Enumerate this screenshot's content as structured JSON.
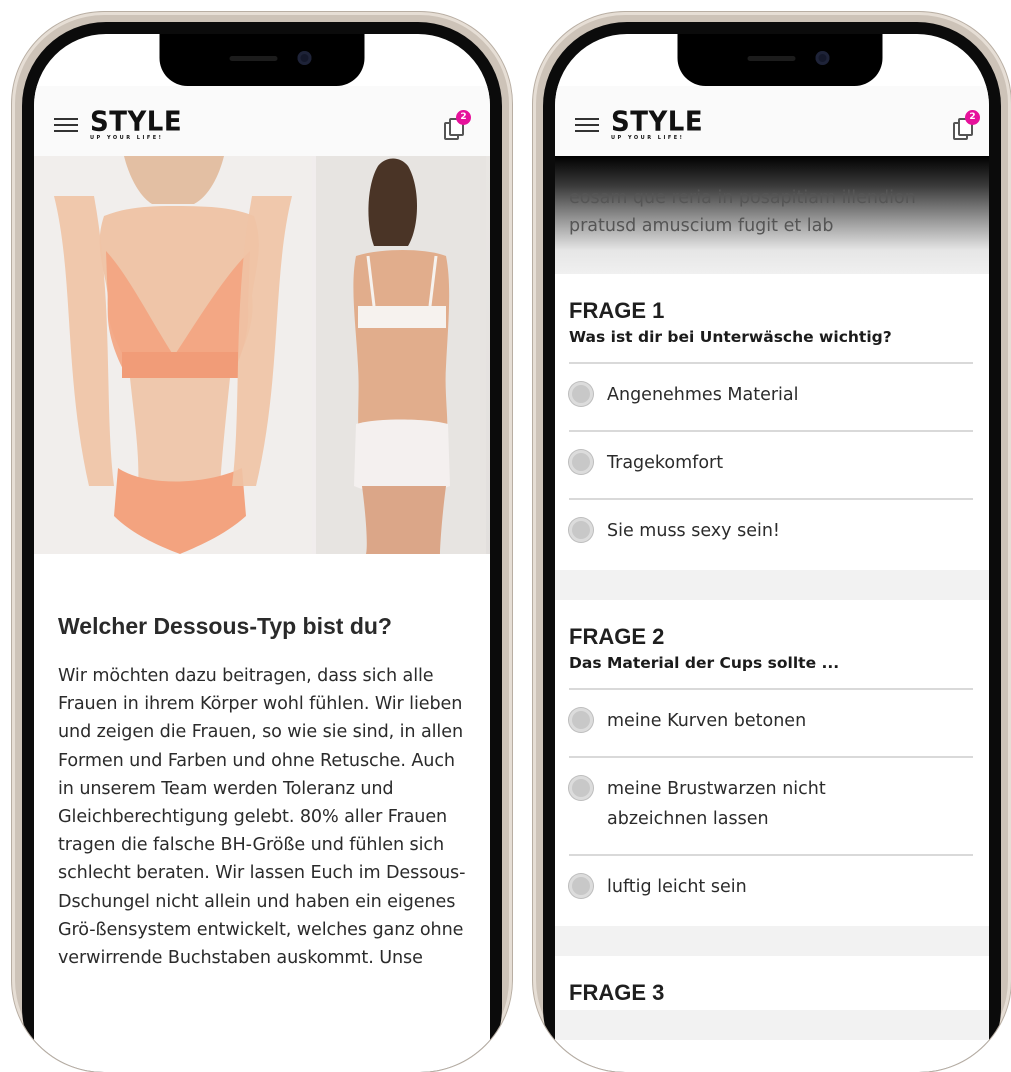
{
  "brand": {
    "logo": "STYLE",
    "tagline": "UP YOUR LIFE!",
    "cart_count": "2"
  },
  "left_screen": {
    "hero_image_alt": "",
    "article": {
      "title": "Welcher Dessous-Typ bist du?",
      "body": "Wir möchten dazu beitragen, dass sich alle Frauen in ihrem Körper wohl fühlen. Wir lieben und zeigen die Frauen, so wie sie sind, in allen Formen und Farben und ohne Retusche. Auch in unserem Team werden Toleranz und Gleichberechtigung gelebt. 80% aller Frauen tragen die falsche BH-Größe und fühlen sich schlecht beraten. Wir lassen Euch im Dessous-Dschungel nicht allein und haben ein eigenes Grö-ßensystem entwickelt, welches ganz ohne verwirrende Buchstaben auskommt. Unse"
    }
  },
  "right_screen": {
    "intro_text": "eosam que reria in posapitiam illendion pratusd amuscium fugit et lab",
    "questions": [
      {
        "head": "FRAGE 1",
        "sub": "Was ist dir bei Unterwäsche wichtig?",
        "options": [
          "Angenehmes Material",
          "Tragekomfort",
          "Sie muss sexy sein!"
        ]
      },
      {
        "head": "FRAGE 2",
        "sub": "Das Material der Cups sollte ...",
        "options": [
          "meine Kurven betonen",
          "meine Brustwarzen nicht abzeichnen lassen",
          "luftig leicht sein"
        ]
      },
      {
        "head": "FRAGE 3",
        "sub": "",
        "options": []
      }
    ]
  },
  "colors": {
    "accent": "#e6129b",
    "frame": "#cdc3b8",
    "text": "#2b2b2b"
  }
}
